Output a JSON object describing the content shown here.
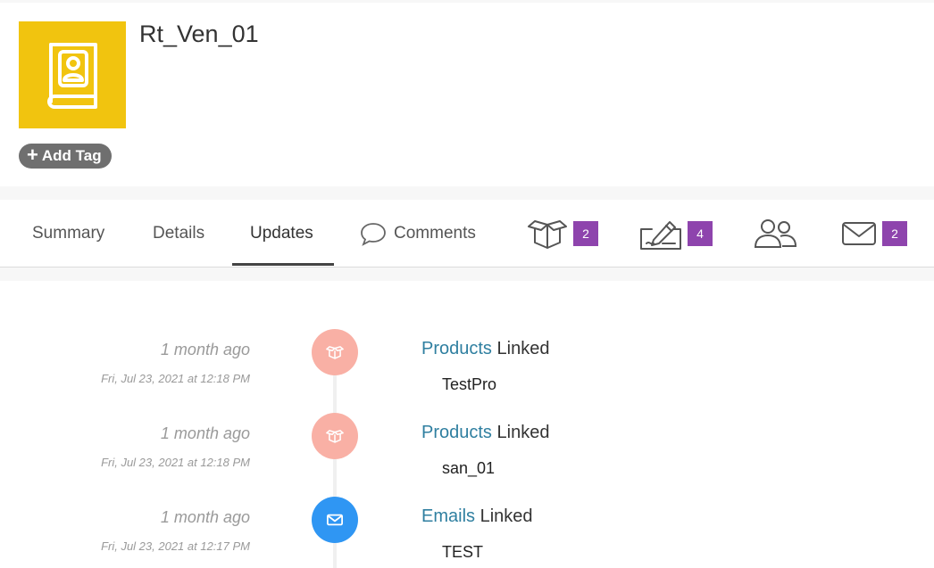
{
  "record": {
    "title": "Rt_Ven_01",
    "add_tag_label": "Add Tag",
    "avatar_icon": "contact-book-icon",
    "avatar_color": "#f1c40f"
  },
  "tabs": {
    "summary": "Summary",
    "details": "Details",
    "updates": "Updates",
    "comments": "Comments",
    "active": "Updates"
  },
  "icon_tabs": {
    "products": {
      "icon": "box-icon",
      "count": "2"
    },
    "notes": {
      "icon": "signature-icon",
      "count": "4"
    },
    "contacts": {
      "icon": "users-icon"
    },
    "emails": {
      "icon": "envelope-icon",
      "count": "2"
    }
  },
  "badge_color": "#8e44ad",
  "timeline": [
    {
      "relative": "1 month ago",
      "date": "Fri, Jul 23, 2021 at 12:18 PM",
      "link": "Products",
      "action": "Linked",
      "item": "TestPro",
      "type": "product"
    },
    {
      "relative": "1 month ago",
      "date": "Fri, Jul 23, 2021 at 12:18 PM",
      "link": "Products",
      "action": "Linked",
      "item": "san_01",
      "type": "product"
    },
    {
      "relative": "1 month ago",
      "date": "Fri, Jul 23, 2021 at 12:17 PM",
      "link": "Emails",
      "action": "Linked",
      "item": "TEST",
      "type": "email"
    }
  ]
}
